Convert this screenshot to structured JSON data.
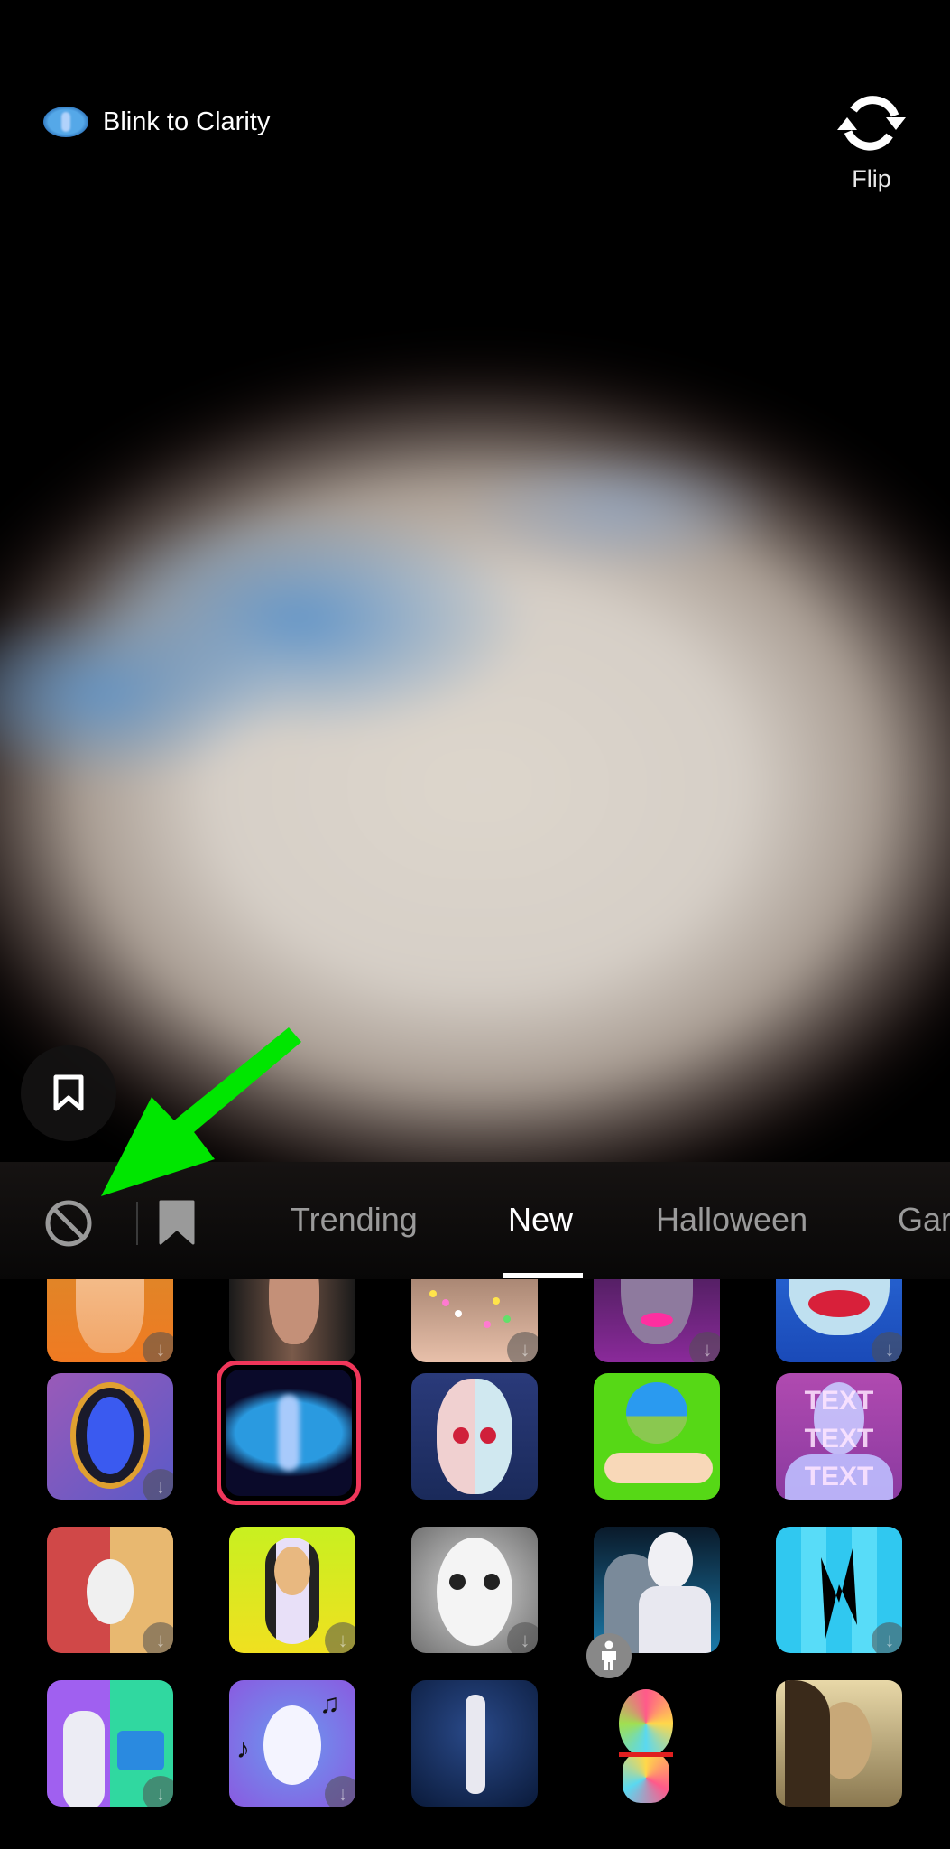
{
  "header": {
    "effect_name": "Blink to Clarity",
    "effect_icon": "blink-eye-figure-icon",
    "flip_label": "Flip",
    "flip_icon": "rotate-arrows-icon"
  },
  "favorite_button_icon": "bookmark-outline-icon",
  "annotation": {
    "type": "green-arrow",
    "color": "#00e600",
    "points_to": "no-effect-button"
  },
  "tabbar": {
    "none_icon": "prohibited-icon",
    "saved_icon": "bookmark-filled-icon",
    "tabs": [
      {
        "label": "Trending",
        "active": false
      },
      {
        "label": "New",
        "active": true
      },
      {
        "label": "Halloween",
        "active": false
      },
      {
        "label": "Gar",
        "active": false
      }
    ]
  },
  "colors": {
    "selected_ring": "#f0365a",
    "active_tab": "#ffffff",
    "inactive_tab": "#9a9a9a"
  },
  "effects": [
    {
      "row": 0,
      "name": "melting-face",
      "downloadable": true
    },
    {
      "row": 0,
      "name": "glam-portrait",
      "downloadable": false
    },
    {
      "row": 0,
      "name": "flower-freckles",
      "downloadable": true
    },
    {
      "row": 0,
      "name": "purple-face-lips",
      "downloadable": true
    },
    {
      "row": 0,
      "name": "blue-face-red-lips",
      "downloadable": true
    },
    {
      "row": 1,
      "name": "mirror-mask",
      "downloadable": true
    },
    {
      "row": 1,
      "name": "blink-to-clarity",
      "downloadable": false,
      "selected": true
    },
    {
      "row": 1,
      "name": "cyborg-mask",
      "downloadable": false
    },
    {
      "row": 1,
      "name": "hand-photo",
      "downloadable": false
    },
    {
      "row": 1,
      "name": "text-face",
      "downloadable": false,
      "text": "TEXT"
    },
    {
      "row": 2,
      "name": "devil-angel",
      "downloadable": true
    },
    {
      "row": 2,
      "name": "cat-costume",
      "downloadable": true
    },
    {
      "row": 2,
      "name": "doll-face",
      "downloadable": true
    },
    {
      "row": 2,
      "name": "reaper-shoulders",
      "downloadable": false,
      "badge": "person-icon"
    },
    {
      "row": 2,
      "name": "lightning-pixels",
      "downloadable": true
    },
    {
      "row": 3,
      "name": "body-photo-upload",
      "downloadable": true
    },
    {
      "row": 3,
      "name": "music-head",
      "downloadable": true
    },
    {
      "row": 3,
      "name": "robot-dance",
      "downloadable": false
    },
    {
      "row": 3,
      "name": "flower-statue",
      "downloadable": true
    },
    {
      "row": 3,
      "name": "sepia-portrait",
      "downloadable": false
    }
  ]
}
